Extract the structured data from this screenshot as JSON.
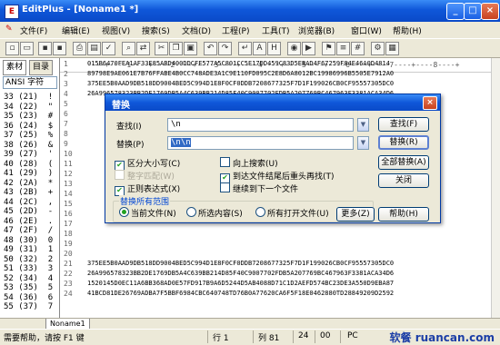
{
  "window": {
    "title": "EditPlus - [Noname1 *]"
  },
  "menu": [
    "文件(F)",
    "编辑(E)",
    "视图(V)",
    "搜索(S)",
    "文档(D)",
    "工程(P)",
    "工具(T)",
    "浏览器(B)",
    "窗口(W)",
    "帮助(H)"
  ],
  "left_panel": {
    "tabs": [
      "素材",
      "目录"
    ],
    "charset": "ANSI 字符",
    "rows": [
      "33 (21)  !",
      "34 (22)  \"",
      "35 (23)  #",
      "36 (24)  $",
      "37 (25)  %",
      "38 (26)  &",
      "39 (27)  '",
      "40 (28)  (",
      "41 (29)  )",
      "42 (2A)  *",
      "43 (2B)  +",
      "44 (2C)  ,",
      "45 (2D)  -",
      "46 (2E)  .",
      "47 (2F)  /",
      "48 (30)  0",
      "49 (31)  1",
      "50 (32)  2",
      "51 (33)  3",
      "52 (34)  4",
      "53 (35)  5",
      "54 (36)  6",
      "55 (37)  7"
    ]
  },
  "editor": {
    "ruler": "----+----1----+----2----+----3----+----4----+----5----+----6----+----7----+----8----+",
    "lines": [
      {
        "n": "1",
        "t": "015B6470FEA1AF33E85ABD400DDCFE577A5C801CC5E17DD459C83D5EBAD4F67259F84E46A0D4814"
      },
      {
        "n": "2",
        "t": "89798E9AE061E7B76FFABE4B0CC748ADE3A1C9E110FD095C2E8D6A8012BC19986996B5505E7912A0"
      },
      {
        "n": "3",
        "t": "375EE5B0AAD9DB518DD9004BED5C994D1E8F0CF0DDB7208677325F7D1F199026CB0CF95557305DC0"
      },
      {
        "n": "4",
        "t": "26A996578323BB2DE1769DB5A4C639BB214D85F40C9007702FDB5A207769BC467963F3381ACA34D6"
      },
      {
        "n": "5",
        "t": ""
      },
      {
        "n": "6",
        "t": ""
      },
      {
        "n": "7",
        "t": ""
      },
      {
        "n": "8",
        "t": ""
      },
      {
        "n": "9",
        "t": ""
      },
      {
        "n": "10",
        "t": ""
      },
      {
        "n": "11",
        "t": ""
      },
      {
        "n": "12",
        "t": ""
      },
      {
        "n": "13",
        "t": ""
      },
      {
        "n": "14",
        "t": ""
      },
      {
        "n": "15",
        "t": ""
      },
      {
        "n": "16",
        "t": ""
      },
      {
        "n": "17",
        "t": ""
      },
      {
        "n": "18",
        "t": ""
      },
      {
        "n": "19",
        "t": ""
      },
      {
        "n": "20",
        "t": ""
      },
      {
        "n": "21",
        "t": "375EE5B0AAD9DB518DD9004BED5C994D1E8F0CF0DDB7208677325F7D1F199026CB0CF95557305DC0"
      },
      {
        "n": "22",
        "t": "26A996578323BB2DE1769DB5A4C639BB214D85F40C9007702FDB5A207769BC467963F3381ACA34D6"
      },
      {
        "n": "23",
        "t": "1520145D0EC11A6BB368AD0E57FD917B9A6D5244D5AB4088D71C1D2AEFD574BC23DE3A550D9EBA87"
      },
      {
        "n": "24",
        "t": "41BCD81DE26769ADBA7F5BBF6984CBC640748TD76B0A77620CA6F5F18E0462880TD28849209D2592"
      }
    ]
  },
  "doc_tab": "Noname1",
  "status": {
    "help": "需要帮助，请按 F1 键",
    "row_label": "行 1",
    "col_label": "列 81",
    "col2": "24",
    "col3": "00",
    "mode": "PC",
    "encoding": "ANSI"
  },
  "watermark": "软餐 ruancan.com",
  "dialog": {
    "title": "替换",
    "find_label": "查找(I)",
    "find_value": "\\n",
    "replace_label": "替换(P)",
    "replace_value": "\\n\\n",
    "buttons": {
      "find": "查找(F)",
      "replace": "替换(R)",
      "replace_all": "全部替换(A)",
      "close": "关闭",
      "more": "更多(Z)",
      "help": "帮助(H)"
    },
    "options": {
      "match_case": "区分大小写(C)",
      "whole_word": "整字匹配(W)",
      "regex": "正则表达式(X)",
      "search_up": "向上搜索(U)",
      "wrap": "到达文件结尾后重头再找(T)",
      "continue_next": "继续到下一个文件"
    },
    "scope": {
      "legend": "替换所有范围",
      "current_file": "当前文件(N)",
      "selection": "所选内容(S)",
      "all_open": "所有打开文件(U)"
    }
  }
}
